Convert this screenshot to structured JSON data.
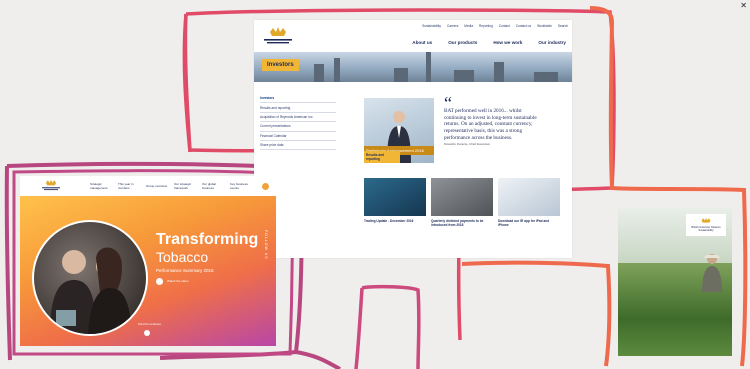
{
  "desktop": {
    "topnav": [
      "Sustainability",
      "Careers",
      "Media",
      "Reporting",
      "Contact",
      "Contact us",
      "Worldwide",
      "Search"
    ],
    "mainnav": [
      "About us",
      "Our products",
      "How we work",
      "Our industry"
    ],
    "hero_tag": "Investors",
    "sidemenu": [
      "Investors",
      "Results and reporting",
      "Acquisition of Reynolds American Inc.",
      "Current presentations",
      "Financial Calendar",
      "Share price data"
    ],
    "feature_caption": "Preliminary Announcement 2016",
    "feature_subcaption": "Results and reporting",
    "quote_mark": "“",
    "quote": "BAT performed well in 2016... whilst continuing to invest in long-term sustainable returns. On an adjusted, constant currency, representative basis, this was a strong performance across the business.",
    "quote_by": "Nicandro Durante, Chief Executive",
    "cards": [
      {
        "title": "Trading Update - December 2016",
        "color": "#1f4c6e"
      },
      {
        "title": "Quarterly dividend payments to be introduced from 2018",
        "color": "#6f7277"
      },
      {
        "title": "Download our IR app for iPad and iPhone",
        "color": "#cfd8e2"
      }
    ]
  },
  "laptop": {
    "nav": [
      "Strategic management",
      "This year in numbers",
      "Group overview",
      "Our strategic framework",
      "Our global business",
      "Key business events"
    ],
    "headline": "Transforming",
    "subheadline": "Tobacco",
    "tagline": "Performance Summary 2016",
    "play_label": "Watch the video",
    "scroll_label": "Scroll to continue",
    "vertical": "FOLLOW US"
  },
  "tablet": {
    "logo_text": "British American Tobacco",
    "sub": "Sustainability"
  },
  "close_glyph": "✕",
  "colors": {
    "accent_gold": "#f2b636",
    "navy": "#1d2a5a",
    "frame_pink": "#cc4a7e",
    "frame_orange": "#ec6a4f"
  }
}
